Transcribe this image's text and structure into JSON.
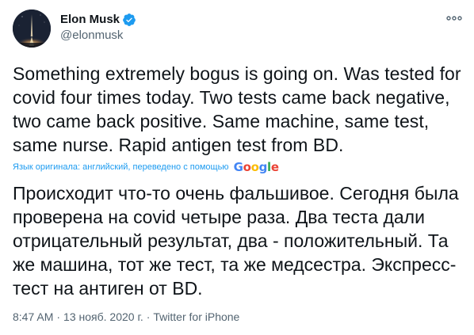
{
  "tweet": {
    "author": {
      "display_name": "Elon Musk",
      "handle": "@elonmusk",
      "verified": true,
      "avatar_icon": "rocket-launch-avatar"
    },
    "more_icon": "more-horizontal-icon",
    "text": "Something extremely bogus is going on. Was tested for covid four times today. Two tests came back negative, two came back positive. Same machine, same test, same nurse. Rapid antigen test from BD.",
    "translation": {
      "note": "Язык оригинала: английский, переведено с помощью",
      "provider": "Google",
      "text": "Происходит что-то очень фальшивое. Сегодня была проверена на covid четыре раза. Два теста дали отрицательный результат, два - положительный. Та же машина, тот же тест, та же медсестра. Экспресс-тест на антиген от BD."
    },
    "meta": {
      "time": "8:47 AM",
      "separator": "·",
      "date": "13 нояб. 2020 г.",
      "source": "Twitter for iPhone"
    }
  },
  "colors": {
    "text_primary": "#0f1419",
    "text_secondary": "#536471",
    "link": "#1d9bf0",
    "verified_badge": "#1d9bf0",
    "google_blue": "#4285f4",
    "google_red": "#ea4335",
    "google_yellow": "#fbbc05",
    "google_green": "#34a853"
  }
}
